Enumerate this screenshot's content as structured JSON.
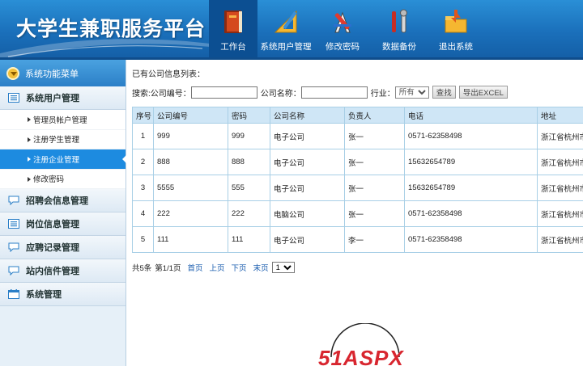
{
  "header": {
    "title": "大学生兼职服务平台",
    "nav": [
      {
        "label": "工作台",
        "icon": "book-icon",
        "active": true
      },
      {
        "label": "系统用户管理",
        "icon": "ruler-icon",
        "active": false
      },
      {
        "label": "修改密码",
        "icon": "tools-icon",
        "active": false
      },
      {
        "label": "数据备份",
        "icon": "wrench-icon",
        "active": false
      },
      {
        "label": "退出系统",
        "icon": "exit-icon",
        "active": false
      }
    ]
  },
  "sidebar": {
    "menu_title": "系统功能菜单",
    "groups": [
      {
        "label": "系统用户管理",
        "icon": "list-icon",
        "items": [
          {
            "label": "管理员帐户管理"
          },
          {
            "label": "注册学生管理"
          },
          {
            "label": "注册企业管理",
            "active": true
          },
          {
            "label": "修改密码"
          }
        ]
      },
      {
        "label": "招聘会信息管理",
        "icon": "chat-icon"
      },
      {
        "label": "岗位信息管理",
        "icon": "list-icon"
      },
      {
        "label": "应聘记录管理",
        "icon": "chat-icon"
      },
      {
        "label": "站内信件管理",
        "icon": "chat-icon"
      },
      {
        "label": "系统管理",
        "icon": "calendar-icon"
      }
    ]
  },
  "main": {
    "list_title": "已有公司信息列表：",
    "search": {
      "prefix": "搜索:",
      "code_label": "公司编号：",
      "code_value": "",
      "name_label": "公司名称：",
      "name_value": "",
      "industry_label": "行业：",
      "industry_selected": "所有",
      "search_button": "查找",
      "export_button": "导出EXCEL"
    },
    "table": {
      "columns": [
        "序号",
        "公司编号",
        "密码",
        "公司名称",
        "负责人",
        "电话",
        "地址"
      ],
      "rows": [
        [
          "1",
          "999",
          "999",
          "电子公司",
          "张一",
          "0571-62358498",
          "浙江省杭州市"
        ],
        [
          "2",
          "888",
          "888",
          "电子公司",
          "张一",
          "15632654789",
          "浙江省杭州市"
        ],
        [
          "3",
          "5555",
          "555",
          "电子公司",
          "张一",
          "15632654789",
          "浙江省杭州市"
        ],
        [
          "4",
          "222",
          "222",
          "电脑公司",
          "张一",
          "0571-62358498",
          "浙江省杭州市"
        ],
        [
          "5",
          "111",
          "111",
          "电子公司",
          "李一",
          "0571-62358498",
          "浙江省杭州市"
        ]
      ]
    },
    "pager": {
      "total": "共5条",
      "page": "第1/1页",
      "first": "首页",
      "prev": "上页",
      "next": "下页",
      "last": "末页",
      "jump_selected": "1"
    }
  },
  "watermark": {
    "text": "51ASPX",
    "color": "#d8262f"
  },
  "colors": {
    "header": "#1a6fba",
    "accent": "#1d8be0",
    "table_header": "#cfe6f6",
    "sidebar": "#e6f0f8"
  }
}
